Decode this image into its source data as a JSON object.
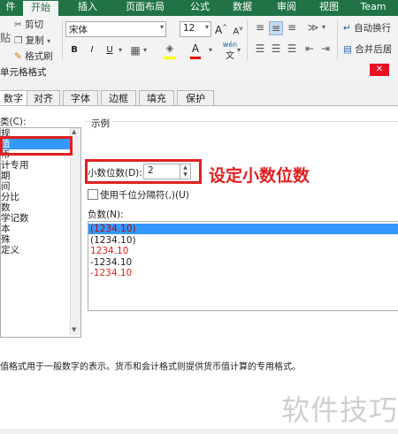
{
  "ribbon": {
    "tabs": [
      "件",
      "开始",
      "插入",
      "页面布局",
      "公式",
      "数据",
      "审阅",
      "视图",
      "Team"
    ],
    "active_tab": "开始",
    "cut": "剪切",
    "copy": "复制",
    "format_painter": "格式刷",
    "paste": "贴",
    "font_name": "宋体",
    "font_size": "12",
    "bold": "B",
    "italic": "I",
    "underline": "U",
    "grow_font": "A",
    "shrink_font": "A",
    "wrap_text": "自动换行",
    "merge_center": "合并后居",
    "phonetic": "wén",
    "font_color_letter": "A"
  },
  "dialog": {
    "title": "单元格格式",
    "tabs": [
      "数字",
      "对齐",
      "字体",
      "边框",
      "填充",
      "保护"
    ],
    "active_tab": "数字",
    "category_label": "类(C):",
    "categories": [
      "规",
      "值",
      "币",
      "计专用",
      "期",
      "间",
      "分比",
      "数",
      "学记数",
      "本",
      "殊",
      "定义"
    ],
    "selected_category": "值",
    "sample_label": "示例",
    "decimal_label": "小数位数(D):",
    "decimal_value": "2",
    "thousands_label": "使用千位分隔符(,)(U)",
    "negative_label": "负数(N):",
    "negative_options": [
      {
        "text": "(1234.10)",
        "color": "#c00000",
        "selected": true
      },
      {
        "text": "(1234.10)",
        "color": "#222222",
        "selected": false
      },
      {
        "text": "1234.10",
        "color": "#e02020",
        "selected": false
      },
      {
        "text": "-1234.10",
        "color": "#222222",
        "selected": false
      },
      {
        "text": "-1234.10",
        "color": "#e02020",
        "selected": false
      }
    ],
    "description": "值格式用于一般数字的表示。货币和会计格式则提供货币值计算的专用格式。"
  },
  "annotation": "设定小数位数",
  "watermark": "软件技巧",
  "colors": {
    "excel_green": "#217346",
    "annotation_red": "#e02020",
    "selection_blue": "#3399ff"
  }
}
